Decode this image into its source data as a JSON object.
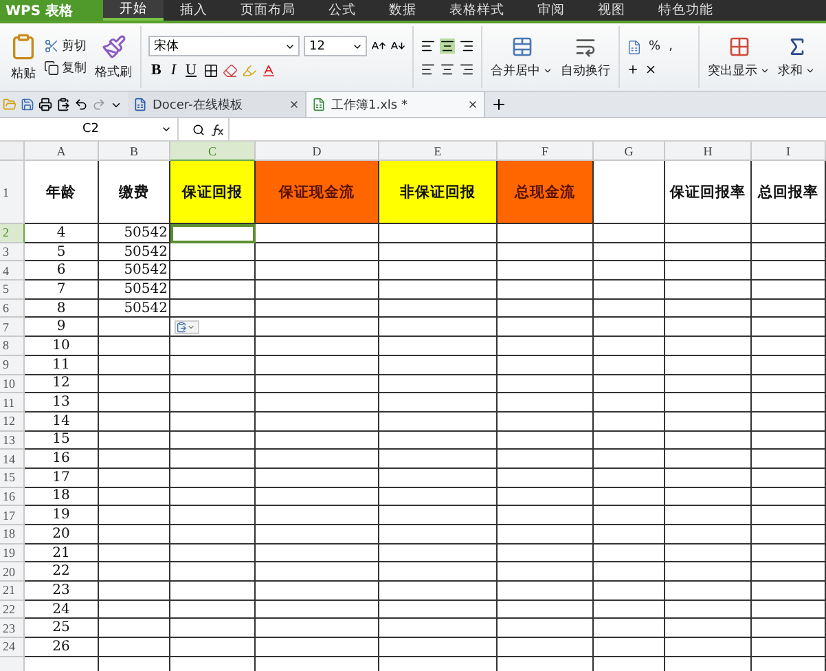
{
  "menu_bar": {
    "app_name": "WPS 表格",
    "tabs": [
      {
        "label": "开始",
        "selected": true
      },
      {
        "label": "插入",
        "selected": false
      },
      {
        "label": "页面布局",
        "selected": false
      },
      {
        "label": "公式",
        "selected": false
      },
      {
        "label": "数据",
        "selected": false
      },
      {
        "label": "表格样式",
        "selected": false
      },
      {
        "label": "审阅",
        "selected": false
      },
      {
        "label": "视图",
        "selected": false
      },
      {
        "label": "特色功能",
        "selected": false
      }
    ]
  },
  "ribbon": {
    "paste": "粘贴",
    "cut": "剪切",
    "copy": "复制",
    "format_painter": "格式刷",
    "font": "宋体",
    "font_size": "12",
    "styles": [
      "B",
      "I",
      "U"
    ],
    "merge": "合并居中",
    "wrap": "自动换行",
    "percent": "%",
    "comma": ",",
    "highlight": "突出显示",
    "sum": "求和"
  },
  "doc_tabs": [
    {
      "label": "Docer-在线模板",
      "selected": false
    },
    {
      "label": "工作簿1.xls *",
      "selected": true
    }
  ],
  "name_box": "C2",
  "columns": [
    {
      "label": "A",
      "selected": false
    },
    {
      "label": "B",
      "selected": false
    },
    {
      "label": "C",
      "selected": true
    },
    {
      "label": "D",
      "selected": false
    },
    {
      "label": "E",
      "selected": false
    },
    {
      "label": "F",
      "selected": false
    },
    {
      "label": "G",
      "selected": false
    },
    {
      "label": "H",
      "selected": false
    },
    {
      "label": "I",
      "selected": false
    }
  ],
  "header_row": {
    "number": "1",
    "cells": [
      {
        "text": "年龄"
      },
      {
        "text": "缴费"
      },
      {
        "text": "保证回报",
        "color": "#ffff00"
      },
      {
        "text": "保证现金流",
        "color": "#ff6600"
      },
      {
        "text": "非保证回报",
        "color": "#ffff00"
      },
      {
        "text": "总现金流",
        "color": "#ff6600"
      },
      {
        "text": ""
      },
      {
        "text": "保证回报率"
      },
      {
        "text": "总回报率"
      }
    ]
  },
  "rows": [
    {
      "number": "2",
      "selected": true,
      "age": "4",
      "payment": "50542"
    },
    {
      "number": "3",
      "selected": false,
      "age": "5",
      "payment": "50542"
    },
    {
      "number": "4",
      "selected": false,
      "age": "6",
      "payment": "50542"
    },
    {
      "number": "5",
      "selected": false,
      "age": "7",
      "payment": "50542"
    },
    {
      "number": "6",
      "selected": false,
      "age": "8",
      "payment": "50542"
    },
    {
      "number": "7",
      "selected": false,
      "age": "9"
    },
    {
      "number": "8",
      "selected": false,
      "age": "10"
    },
    {
      "number": "9",
      "selected": false,
      "age": "11"
    },
    {
      "number": "10",
      "selected": false,
      "age": "12"
    },
    {
      "number": "11",
      "selected": false,
      "age": "13"
    },
    {
      "number": "12",
      "selected": false,
      "age": "14"
    },
    {
      "number": "13",
      "selected": false,
      "age": "15"
    },
    {
      "number": "14",
      "selected": false,
      "age": "16"
    },
    {
      "number": "15",
      "selected": false,
      "age": "17"
    },
    {
      "number": "16",
      "selected": false,
      "age": "18"
    },
    {
      "number": "17",
      "selected": false,
      "age": "19"
    },
    {
      "number": "18",
      "selected": false,
      "age": "20"
    },
    {
      "number": "19",
      "selected": false,
      "age": "21"
    },
    {
      "number": "20",
      "selected": false,
      "age": "22"
    },
    {
      "number": "21",
      "selected": false,
      "age": "23"
    },
    {
      "number": "22",
      "selected": false,
      "age": "24"
    },
    {
      "number": "23",
      "selected": false,
      "age": "25"
    },
    {
      "number": "24",
      "selected": false,
      "age": "26"
    }
  ]
}
